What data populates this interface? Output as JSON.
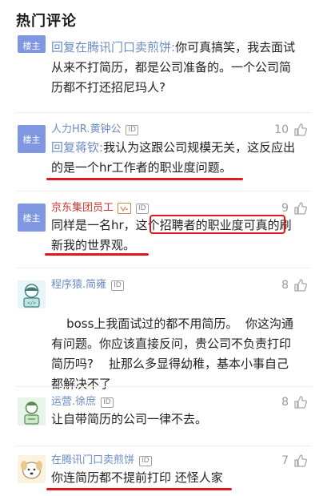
{
  "header": {
    "title": "热门评论"
  },
  "comments": [
    {
      "avatar_text": "楼主",
      "reply_prefix": "回复在腾讯门口卖煎饼:",
      "text": "你可真搞笑，我去面试从来不打简历，都是公司准备的。一个公司简历都不打还招尼玛人?"
    },
    {
      "avatar_text": "楼主",
      "author": "人力HR.黄钟公",
      "id_badge": "ID",
      "likes": "10",
      "reply_prefix": "回复蒋钦:",
      "text": "我认为这跟公司规模无关，这反应出的是一个hr工作者的职业度问题。"
    },
    {
      "avatar_text": "楼主",
      "author": "京东集团员工",
      "verified_badge": "verified-v-icon",
      "id_badge": "ID",
      "likes": "9",
      "text": "同样是一名hr，这个招聘者的职业度可真的刷新我的世界观。"
    },
    {
      "author": "程序猿.简雍",
      "id_badge": "ID",
      "likes": "8",
      "text": "boss上我面试过的都不用简历。  你这沟通有问题。你应该直接反问，贵公司不负责打印简历吗?    扯那么多显得幼稚，基本小事自己都解决不了"
    },
    {
      "author": "运营.徐庶",
      "id_badge": "ID",
      "likes": "8",
      "text": "让自带简历的公司一律不去。"
    },
    {
      "author": "在腾讯门口卖煎饼",
      "id_badge": "ID",
      "likes": "7",
      "text": "你连简历都不提前打印 还怪人家"
    }
  ],
  "colors": {
    "link_blue": "#6b8cc4",
    "highlight_red": "#e0171d",
    "owner_avatar": "#7f96e0",
    "like_gray": "#9a9a9a"
  }
}
